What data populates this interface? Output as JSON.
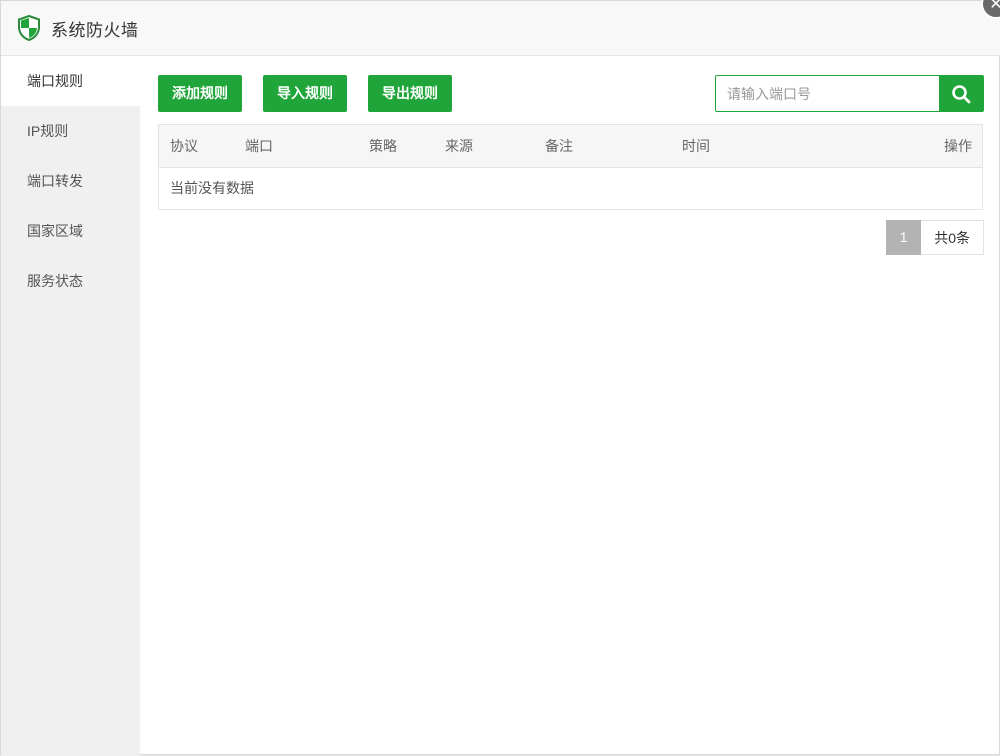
{
  "window": {
    "title": "系统防火墙"
  },
  "sidebar": {
    "items": [
      {
        "label": "端口规则",
        "active": true
      },
      {
        "label": "IP规则"
      },
      {
        "label": "端口转发"
      },
      {
        "label": "国家区域"
      },
      {
        "label": "服务状态"
      }
    ]
  },
  "toolbar": {
    "add_label": "添加规则",
    "import_label": "导入规则",
    "export_label": "导出规则",
    "search_placeholder": "请输入端口号",
    "search_value": ""
  },
  "table": {
    "columns": [
      "协议",
      "端口",
      "策略",
      "来源",
      "备注",
      "时间",
      "操作"
    ],
    "empty_text": "当前没有数据"
  },
  "pagination": {
    "current": "1",
    "total": "共0条"
  },
  "colors": {
    "accent": "#20a53a",
    "sidebar_bg": "#f0f0f0",
    "pager_active": "#b3b3b3"
  },
  "icons": {
    "app": "shield-icon",
    "search": "search-icon",
    "close": "close-icon"
  }
}
